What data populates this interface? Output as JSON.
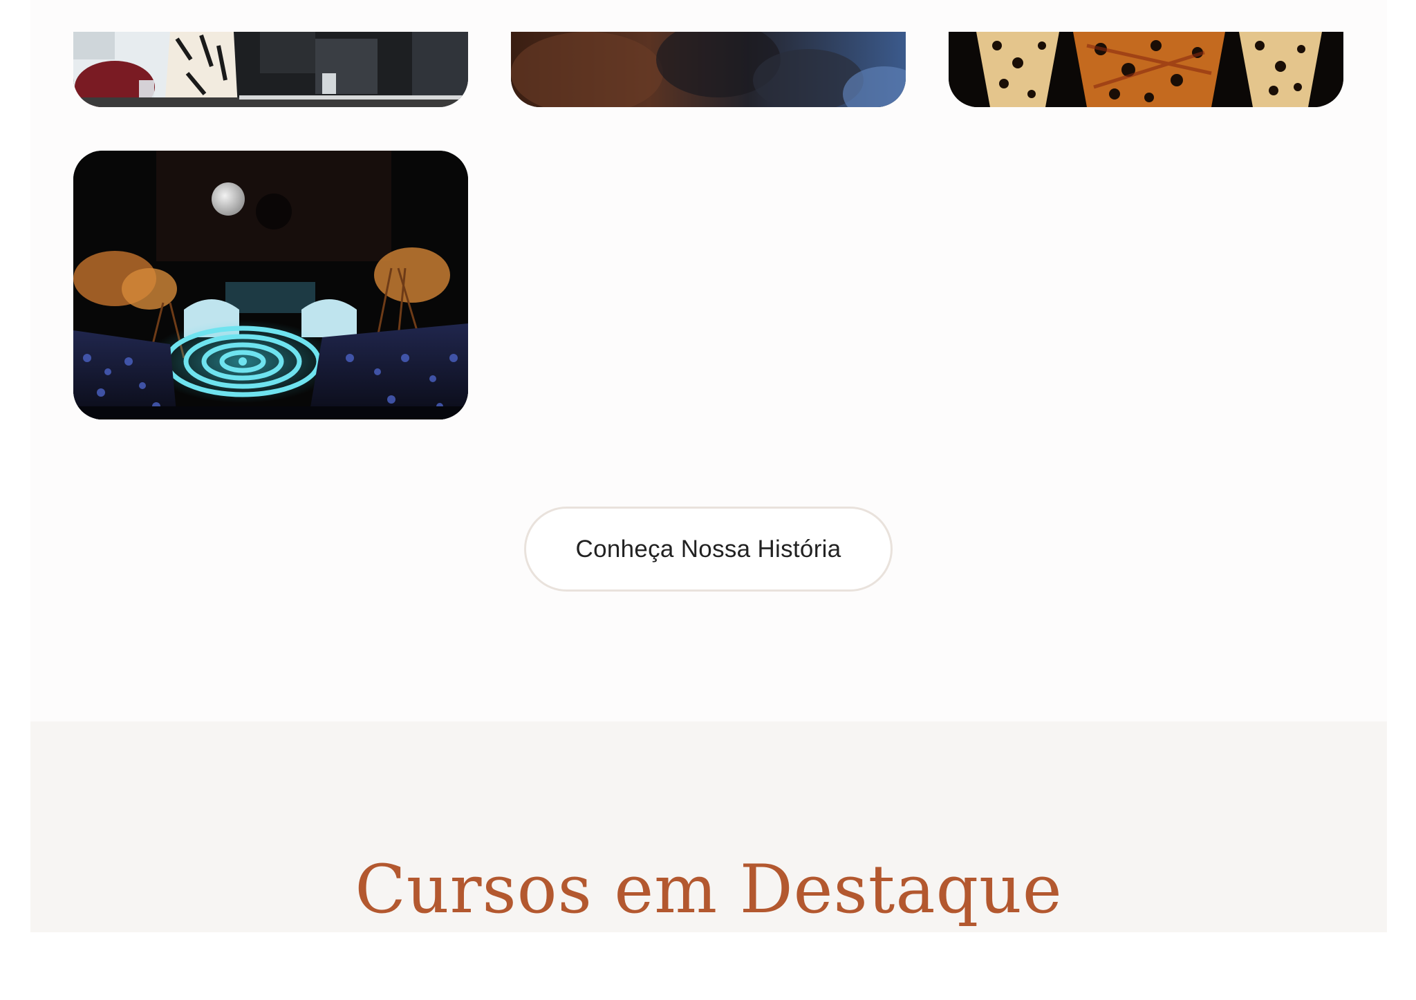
{
  "gallery": {
    "photos": [
      {
        "alt": "",
        "icon": "photo-meeting-table"
      },
      {
        "alt": "",
        "icon": "photo-blurred-audience"
      },
      {
        "alt": "",
        "icon": "photo-jaguar-costumes"
      },
      {
        "alt": "",
        "icon": "photo-night-stage-spiral"
      }
    ],
    "history_button_label": "Conheça Nossa História"
  },
  "courses": {
    "title": "Cursos em Destaque"
  },
  "colors": {
    "page_background": "#ffffff",
    "gallery_background": "#fdfcfc",
    "courses_background": "#f7f5f3",
    "title_accent": "#b3582f",
    "button_border": "#e9e2dc",
    "button_text": "#222222"
  }
}
